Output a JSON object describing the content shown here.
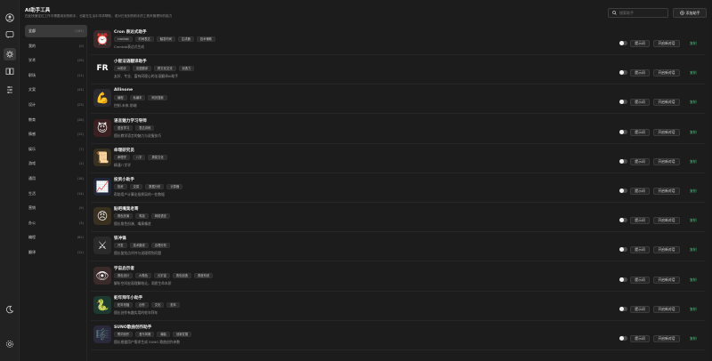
{
  "header": {
    "title": "AI助手工具",
    "subtitle": "在此快速定位工作中需要用到的助手，也能在生活中寻求帮助，或对已找到的助手的工具来管理你的能力",
    "search_placeholder": "搜索助手",
    "add_label": "添加助手"
  },
  "rail": {
    "icons": [
      "user-icon",
      "chat-icon",
      "assistant-icon",
      "book-icon",
      "settings-sliders-icon",
      "moon-icon",
      "gear-icon"
    ]
  },
  "categories": [
    {
      "label": "全部",
      "count": "(185)"
    },
    {
      "label": "我的",
      "count": "(0)"
    },
    {
      "label": "学术",
      "count": "(19)"
    },
    {
      "label": "职场",
      "count": "(11)"
    },
    {
      "label": "文案",
      "count": "(43)"
    },
    {
      "label": "设计",
      "count": "(23)"
    },
    {
      "label": "教育",
      "count": "(28)"
    },
    {
      "label": "情感",
      "count": "(12)"
    },
    {
      "label": "娱乐",
      "count": "(7)"
    },
    {
      "label": "游戏",
      "count": "(2)"
    },
    {
      "label": "通用",
      "count": "(18)"
    },
    {
      "label": "生活",
      "count": "(14)"
    },
    {
      "label": "营销",
      "count": "(9)"
    },
    {
      "label": "办公",
      "count": "(3)"
    },
    {
      "label": "编程",
      "count": "(62)"
    },
    {
      "label": "翻译",
      "count": "(12)"
    }
  ],
  "actions": {
    "prompt_label": "提示词",
    "chat_label": "开启新对话",
    "copy_label": "复制"
  },
  "assistants": [
    {
      "name": "Cron 表达式助手",
      "tags": [
        "crontab",
        "时间表达",
        "触发时间",
        "生成器",
        "技术辅助"
      ],
      "desc": "Crontab表达式生成",
      "avatar": "⏰",
      "bg": "#3a2a2a"
    },
    {
      "name": "小智法语翻译助手",
      "tags": [
        "AI助手",
        "法语翻译",
        "跨文化交流",
        "创造力"
      ],
      "desc": "友好、专业、富有同理心的法语翻译AI助手",
      "avatar": "FR",
      "bg": "#1c1c1c"
    },
    {
      "name": "Allinone",
      "tags": [
        "编程",
        "私编本",
        "网页搜索"
      ],
      "desc": "控制-未来-前端",
      "avatar": "💪",
      "bg": "#2a2a30"
    },
    {
      "name": "语言魅力学习导师",
      "tags": [
        "语言学习",
        "表达训练"
      ],
      "desc": "擅长教学语言的魅力与说服技巧",
      "avatar": "😈",
      "bg": "#3a2020"
    },
    {
      "name": "命理研究员",
      "tags": [
        "命理学",
        "八字",
        "周易文化"
      ],
      "desc": "精通八字学",
      "avatar": "📜",
      "bg": "#3a3020"
    },
    {
      "name": "投资小助手",
      "tags": [
        "投资",
        "交易",
        "数据分析",
        "计算器"
      ],
      "desc": "帮助用户计算出指挥局的一些数据",
      "avatar": "📈",
      "bg": "#20283a"
    },
    {
      "name": "贴吧嘴臭老哥",
      "tags": [
        "角色扮演",
        "嘴臭",
        "网络语言"
      ],
      "desc": "擅长角色扮演、嘴臭嘴贫",
      "avatar": "😠",
      "bg": "#3a3020"
    },
    {
      "name": "铁冲锋",
      "tags": [
        "开发",
        "技术路线",
        "合理分析"
      ],
      "desc": "擅长鉴别点评并与说理得到问题",
      "avatar": "⚔",
      "bg": "#2a2a2a"
    },
    {
      "name": "宇宙启示者",
      "tags": [
        "角色设计",
        "AI角色",
        "元宇宙",
        "角色创造",
        "角度系统"
      ],
      "desc": "解析空间宏观理解结论，洞悉生命本质",
      "avatar": "👁",
      "bg": "#3a2a2a"
    },
    {
      "name": "蛇年拜年小助手",
      "tags": [
        "蛇年祝福",
        "创作",
        "文化",
        "蛇年"
      ],
      "desc": "擅长创作有趣实用的蛇年拜年",
      "avatar": "🐍",
      "bg": "#1e3a30"
    },
    {
      "name": "SUNO歌曲创作助手",
      "tags": [
        "歌词创作",
        "音乐风格",
        "编曲",
        "创新发展"
      ],
      "desc": "擅长根据用户需求生成 SUNO 歌曲创作参数",
      "avatar": "🎼",
      "bg": "#2a2a3a"
    }
  ]
}
